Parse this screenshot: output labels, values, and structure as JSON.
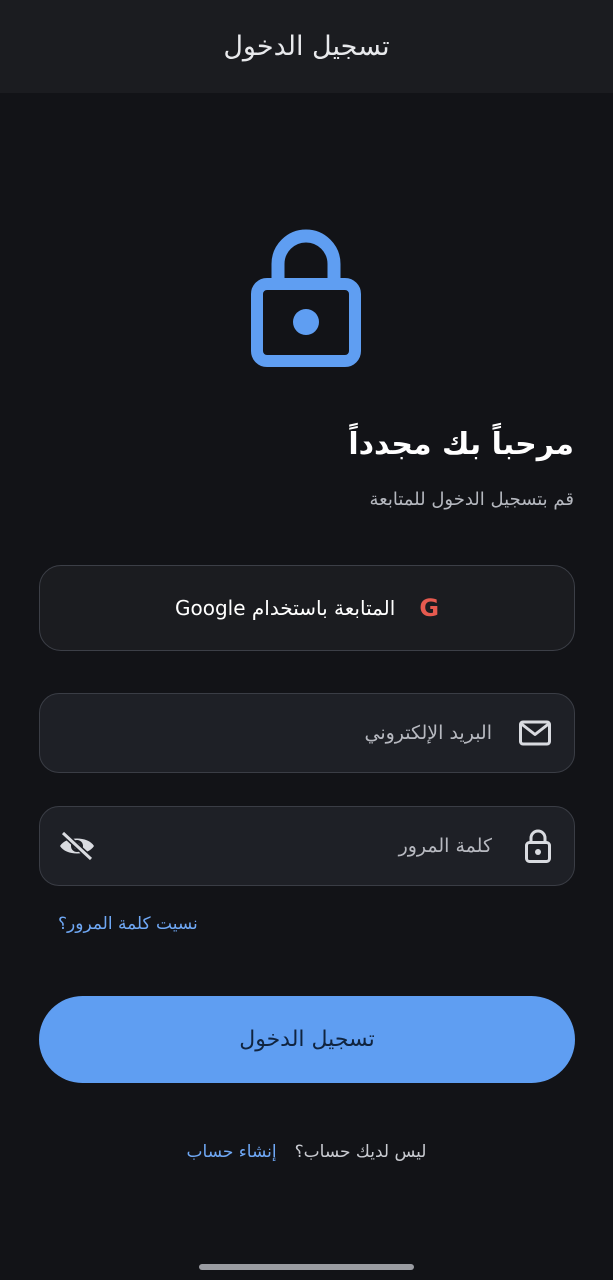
{
  "app_bar": {
    "title": "تسجيل الدخول"
  },
  "hero": {
    "icon": "lock-icon",
    "color": "#5f9ef2"
  },
  "welcome": {
    "title": "مرحباً بك مجدداً",
    "subtitle": "قم بتسجيل الدخول للمتابعة"
  },
  "google_button": {
    "icon_letter": "G",
    "label": "المتابعة باستخدام Google",
    "icon_color": "#e65a4f"
  },
  "email_field": {
    "icon": "mail-icon",
    "placeholder": "البريد الإلكتروني",
    "value": ""
  },
  "password_field": {
    "icon": "lock-icon",
    "toggle_icon": "eye-off-icon",
    "placeholder": "كلمة المرور",
    "value": ""
  },
  "forgot_password": {
    "label": "نسيت كلمة المرور؟"
  },
  "login_button": {
    "label": "تسجيل الدخول",
    "color": "#5f9ef2"
  },
  "signup": {
    "prompt": "ليس لديك حساب؟",
    "link_label": "إنشاء حساب"
  },
  "colors": {
    "background": "#121317",
    "accent": "#5f9ef2",
    "link": "#6fa8f5"
  }
}
